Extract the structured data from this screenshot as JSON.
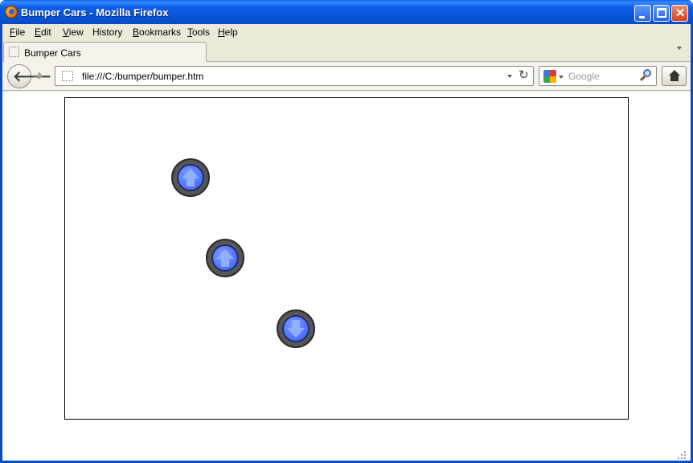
{
  "window": {
    "title": "Bumper Cars - Mozilla Firefox",
    "app_icon": "firefox-icon",
    "controls": [
      "minimize-icon",
      "maximize-icon",
      "close-icon"
    ]
  },
  "menubar": {
    "items": [
      {
        "label": "File",
        "access": "F",
        "rest": "ile"
      },
      {
        "label": "Edit",
        "access": "E",
        "rest": "dit"
      },
      {
        "label": "View",
        "access": "V",
        "rest": "iew"
      },
      {
        "label": "History",
        "access": "",
        "rest": "History"
      },
      {
        "label": "Bookmarks",
        "access": "B",
        "rest": "ookmarks"
      },
      {
        "label": "Tools",
        "access": "T",
        "rest": "ools"
      },
      {
        "label": "Help",
        "access": "H",
        "rest": "elp"
      }
    ]
  },
  "tabs": [
    {
      "label": "Bumper Cars",
      "active": true
    }
  ],
  "navbar": {
    "url": "file:///C:/bumper/bumper.htm",
    "search_placeholder": "Google",
    "search_engine_icon": "google-icon"
  },
  "arena": {
    "cars": [
      {
        "name": "car-1",
        "direction": "up"
      },
      {
        "name": "car-2",
        "direction": "up"
      },
      {
        "name": "car-3",
        "direction": "down"
      }
    ],
    "colors": {
      "car_body": "#4d6fff",
      "car_ring": "#4a4a4a",
      "arrow": "#8fb0ff"
    }
  }
}
